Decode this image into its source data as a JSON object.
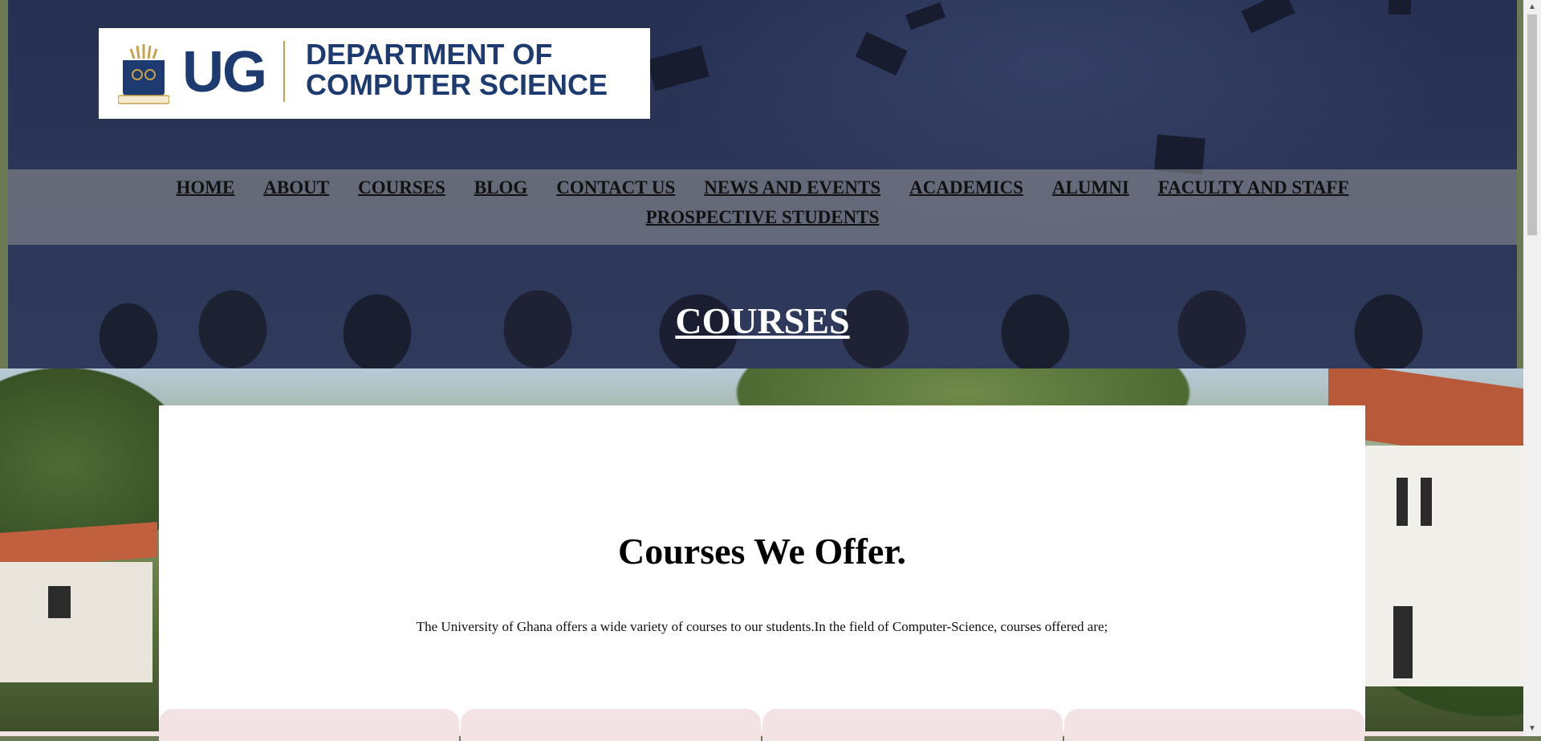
{
  "logo": {
    "short": "UG",
    "dept_line1": "DEPARTMENT OF",
    "dept_line2": "COMPUTER SCIENCE"
  },
  "nav": {
    "row1": [
      "HOME",
      "ABOUT",
      "COURSES",
      "BLOG",
      "CONTACT US",
      "NEWS AND EVENTS",
      "ACADEMICS",
      "ALUMNI",
      "FACULTY AND STAFF"
    ],
    "row2": [
      "PROSPECTIVE STUDENTS"
    ]
  },
  "hero": {
    "title": "COURSES"
  },
  "main": {
    "heading": "Courses We Offer.",
    "intro": "The University of Ghana offers a wide variety of courses to our students.In the field of Computer-Science, courses offered are;"
  },
  "colors": {
    "brand_blue": "#1d3b70",
    "brand_gold": "#c8a24a",
    "tile_pink": "#f3e3e4"
  }
}
